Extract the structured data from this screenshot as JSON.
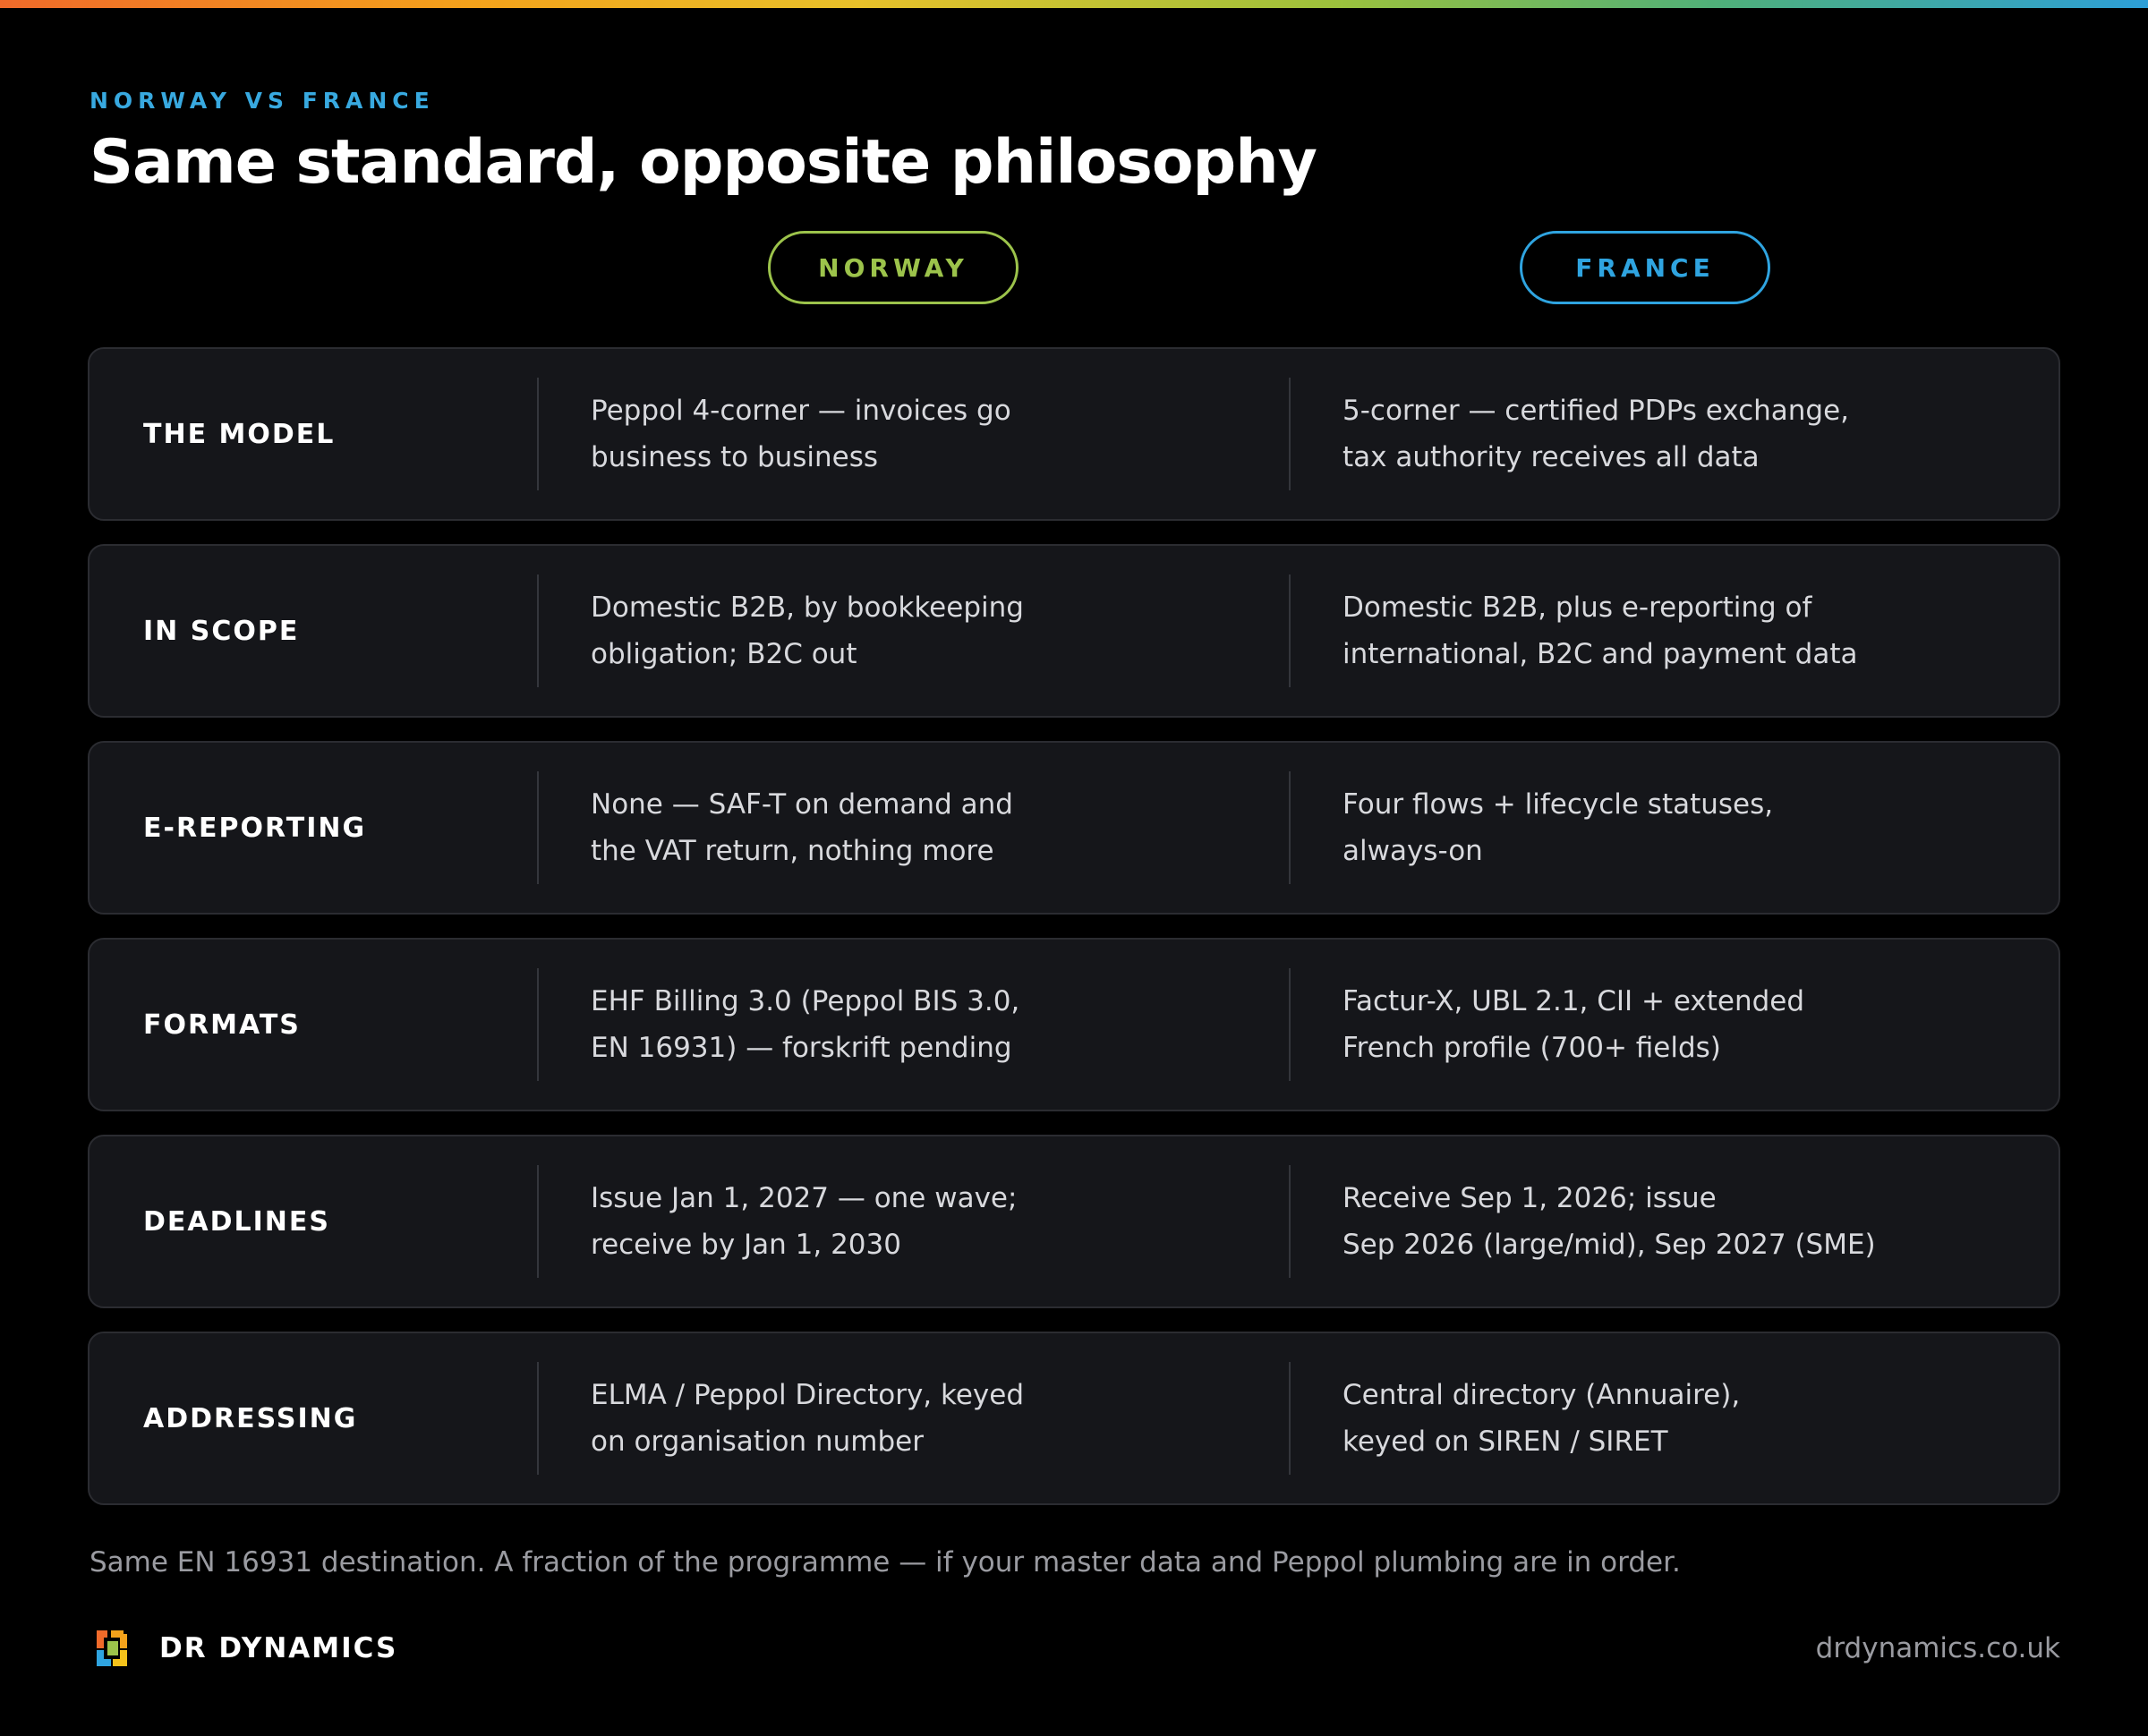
{
  "header": {
    "eyebrow": "NORWAY VS FRANCE",
    "title": "Same standard, opposite philosophy"
  },
  "columns": {
    "norway": "NORWAY",
    "france": "FRANCE"
  },
  "rows": [
    {
      "label": "THE MODEL",
      "norway": [
        "Peppol 4-corner — invoices go",
        "business to business"
      ],
      "france": [
        "5-corner — certified PDPs exchange,",
        "tax authority receives all data"
      ]
    },
    {
      "label": "IN SCOPE",
      "norway": [
        "Domestic B2B, by bookkeeping",
        "obligation; B2C out"
      ],
      "france": [
        "Domestic B2B, plus e-reporting of",
        "international, B2C and payment data"
      ]
    },
    {
      "label": "E-REPORTING",
      "norway": [
        "None — SAF-T on demand and",
        "the VAT return, nothing more"
      ],
      "france": [
        "Four flows + lifecycle statuses,",
        "always-on"
      ]
    },
    {
      "label": "FORMATS",
      "norway": [
        "EHF Billing 3.0 (Peppol BIS 3.0,",
        "EN 16931) — forskrift pending"
      ],
      "france": [
        "Factur-X, UBL 2.1, CII + extended",
        "French profile (700+ fields)"
      ]
    },
    {
      "label": "DEADLINES",
      "norway": [
        "Issue Jan 1, 2027 — one wave;",
        "receive by Jan 1, 2030"
      ],
      "france": [
        "Receive Sep 1, 2026; issue",
        "Sep 2026 (large/mid), Sep 2027 (SME)"
      ]
    },
    {
      "label": "ADDRESSING",
      "norway": [
        "ELMA / Peppol Directory, keyed",
        "on organisation number"
      ],
      "france": [
        "Central directory (Annuaire),",
        "keyed on SIREN / SIRET"
      ]
    }
  ],
  "footnote": "Same EN 16931 destination. A fraction of the programme — if your master data and Peppol plumbing are in order.",
  "footer": {
    "brand": "DR DYNAMICS",
    "website": "drdynamics.co.uk",
    "logo_icon": "dr-dynamics-logo-icon"
  },
  "colors": {
    "norway_accent": "#9cc34b",
    "france_accent": "#2fa4e0",
    "eyebrow": "#38a9e0",
    "card_bg": "#15161a"
  }
}
